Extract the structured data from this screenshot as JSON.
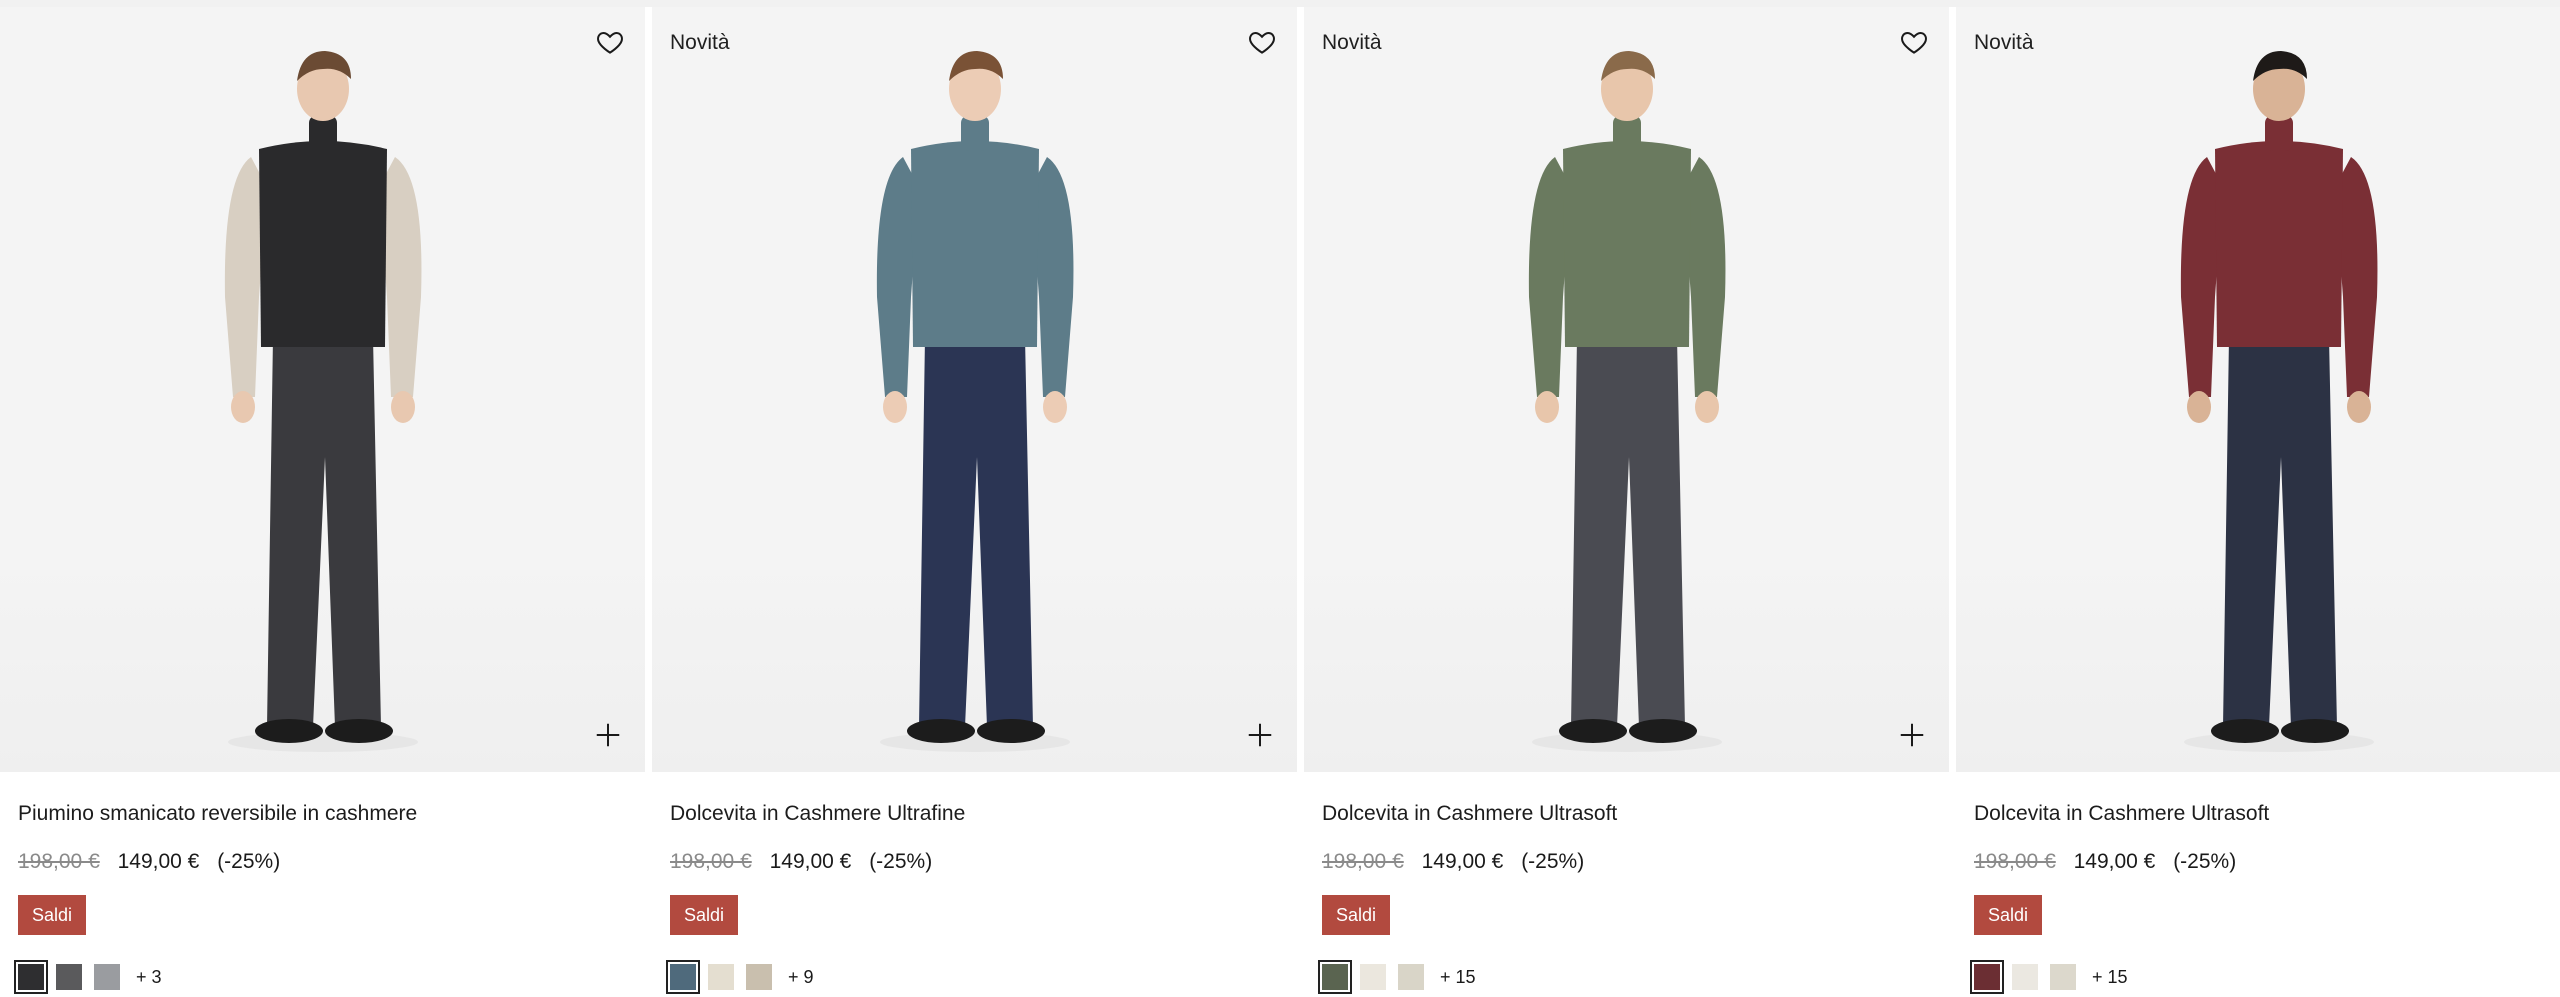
{
  "products": [
    {
      "badge": "",
      "title": "Piumino smanicato reversibile in cashmere",
      "old_price": "198,00 €",
      "new_price": "149,00 €",
      "discount": "(-25%)",
      "sale_label": "Saldi",
      "more_colors": "+ 3",
      "swatches": [
        "#2e2e30",
        "#5a5a5c",
        "#9a9ca0"
      ],
      "colors": {
        "top": "#2a2a2c",
        "sleeve": "#d8cfc2",
        "pants": "#3a3a3e",
        "shoes": "#1c1c1c",
        "skin": "#e8c8b0",
        "hair": "#6b4b34"
      }
    },
    {
      "badge": "Novità",
      "title": "Dolcevita in Cashmere Ultrafine",
      "old_price": "198,00 €",
      "new_price": "149,00 €",
      "discount": "(-25%)",
      "sale_label": "Saldi",
      "more_colors": "+ 9",
      "swatches": [
        "#4f6a7c",
        "#e4ded0",
        "#c9bfae"
      ],
      "colors": {
        "top": "#5d7c89",
        "sleeve": "#5d7c89",
        "pants": "#2b3554",
        "shoes": "#1c1c1c",
        "skin": "#ecccb5",
        "hair": "#7a5236"
      }
    },
    {
      "badge": "Novità",
      "title": "Dolcevita in Cashmere Ultrasoft",
      "old_price": "198,00 €",
      "new_price": "149,00 €",
      "discount": "(-25%)",
      "sale_label": "Saldi",
      "more_colors": "+ 15",
      "swatches": [
        "#5a6450",
        "#ebe7de",
        "#d9d5c8"
      ],
      "colors": {
        "top": "#6a7a5f",
        "sleeve": "#6a7a5f",
        "pants": "#4a4b52",
        "shoes": "#1c1c1c",
        "skin": "#e8c6ab",
        "hair": "#8a6a4a"
      }
    },
    {
      "badge": "Novità",
      "title": "Dolcevita in Cashmere Ultrasoft",
      "old_price": "198,00 €",
      "new_price": "149,00 €",
      "discount": "(-25%)",
      "sale_label": "Saldi",
      "more_colors": "+ 15",
      "swatches": [
        "#6b2e33",
        "#ebe8e1",
        "#dcd8cc"
      ],
      "colors": {
        "top": "#7a2f35",
        "sleeve": "#7a2f35",
        "pants": "#2c3244",
        "shoes": "#1c1c1c",
        "skin": "#d9b396",
        "hair": "#1e1a18"
      }
    }
  ],
  "theme": {
    "sale_bg": "#b24a3f",
    "media_bg": "#f4f4f4"
  },
  "icons": {
    "wishlist": "heart-outline-icon",
    "quick_add": "plus-icon"
  }
}
